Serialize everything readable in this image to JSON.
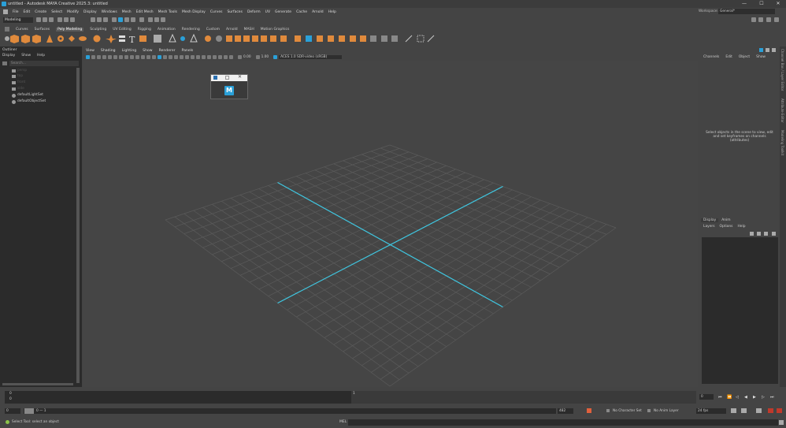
{
  "window": {
    "title": "untitled - Autodesk MAYA Creative 2025.3: untitled",
    "minimize": "—",
    "maximize": "☐",
    "close": "✕"
  },
  "menubar": {
    "items": [
      "File",
      "Edit",
      "Create",
      "Select",
      "Modify",
      "Display",
      "Windows",
      "Mesh",
      "Edit Mesh",
      "Mesh Tools",
      "Mesh Display",
      "Curves",
      "Surfaces",
      "Deform",
      "UV",
      "Generate",
      "Cache",
      "Arnold",
      "Help"
    ],
    "workspace_label": "Workspace:",
    "workspace_value": "General*"
  },
  "statusline": {
    "mode": "Modeling"
  },
  "shelf": {
    "tabs": [
      "Curves",
      "Surfaces",
      "Poly Modeling",
      "Sculpting",
      "UV Editing",
      "Rigging",
      "Animation",
      "Rendering",
      "Custom",
      "Arnold",
      "MASH",
      "Motion Graphics"
    ],
    "active_tab": "Poly Modeling"
  },
  "outliner": {
    "title": "Outliner",
    "menu": [
      "Display",
      "Show",
      "Help"
    ],
    "search_placeholder": "Search...",
    "items": [
      "persp",
      "top",
      "front",
      "side",
      "defaultLightSet",
      "defaultObjectSet"
    ]
  },
  "viewport": {
    "menu": [
      "View",
      "Shading",
      "Lighting",
      "Show",
      "Renderer",
      "Panels"
    ],
    "exposure": "0.00",
    "gamma": "1.00",
    "color_space": "ACES 1.0 SDR-video (sRGB)",
    "grid_color": "#5b5b5b",
    "axis_color": "#3fc6e0"
  },
  "splash": {
    "logo_letter": "M",
    "logo_sub": "MAYA"
  },
  "channelbox": {
    "tabs": [
      "Channels",
      "Edit",
      "Object",
      "Show"
    ],
    "hint": "Select objects in the scene to view, edit and set keyframes on channels (attributes)",
    "layer_tabs": [
      "Display",
      "Anim"
    ],
    "layer_menu": [
      "Layers",
      "Options",
      "Help"
    ],
    "side_labels": [
      "Channel Box / Layer Editor",
      "Attribute Editor",
      "Modeling Toolkit"
    ]
  },
  "timeslider": {
    "tick_start": "0",
    "tick_end": "1",
    "current_frame": "0"
  },
  "rangeslider": {
    "start": "0",
    "inner_start": "0",
    "inner_label": "0 — 1",
    "end": "482",
    "character_set": "No Character Set",
    "anim_layer": "No Anim Layer",
    "fps": "24 fps"
  },
  "helpline": {
    "text": "Select Tool: select an object",
    "mel_label": "MEL"
  }
}
